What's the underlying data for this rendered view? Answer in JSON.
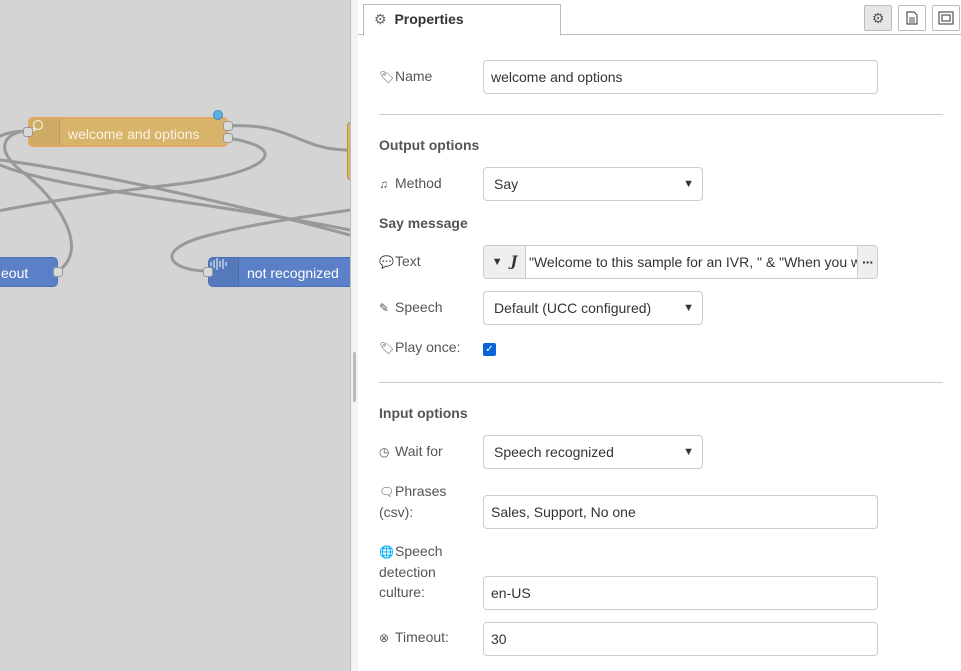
{
  "canvas": {
    "nodes": {
      "welcome": "welcome and options",
      "timeout": "eout",
      "not_recognized": "not recognized"
    }
  },
  "sidebar": {
    "tab_label": "Properties",
    "buttons": {
      "settings": "gear-icon",
      "description": "file-icon",
      "appearance": "appearance-icon"
    }
  },
  "form": {
    "name": {
      "label": "Name",
      "value": "welcome and options"
    },
    "output_options": {
      "title": "Output options",
      "method": {
        "label": "Method",
        "value": "Say"
      },
      "say_message_title": "Say message",
      "text": {
        "label": "Text",
        "value": "\"Welcome to this sample for an IVR, \" & \"When you w"
      },
      "speech": {
        "label": "Speech",
        "value": "Default (UCC configured)"
      },
      "play_once": {
        "label": "Play once:",
        "checked": true
      }
    },
    "input_options": {
      "title": "Input options",
      "wait_for": {
        "label": "Wait for",
        "value": "Speech recognized"
      },
      "phrases": {
        "label_line1": "Phrases",
        "label_line2": "(csv):",
        "value": "Sales, Support, No one"
      },
      "culture": {
        "label_line1": "Speech",
        "label_line2": "detection",
        "label_line3": "culture:",
        "value": "en-US"
      },
      "timeout": {
        "label": "Timeout:",
        "value": "30"
      }
    }
  },
  "colors": {
    "canvas_bg": "#d4d4d4",
    "node_orange": "#d9b366",
    "node_blue": "#5b80c7",
    "checkbox_blue": "#0a66d8"
  }
}
